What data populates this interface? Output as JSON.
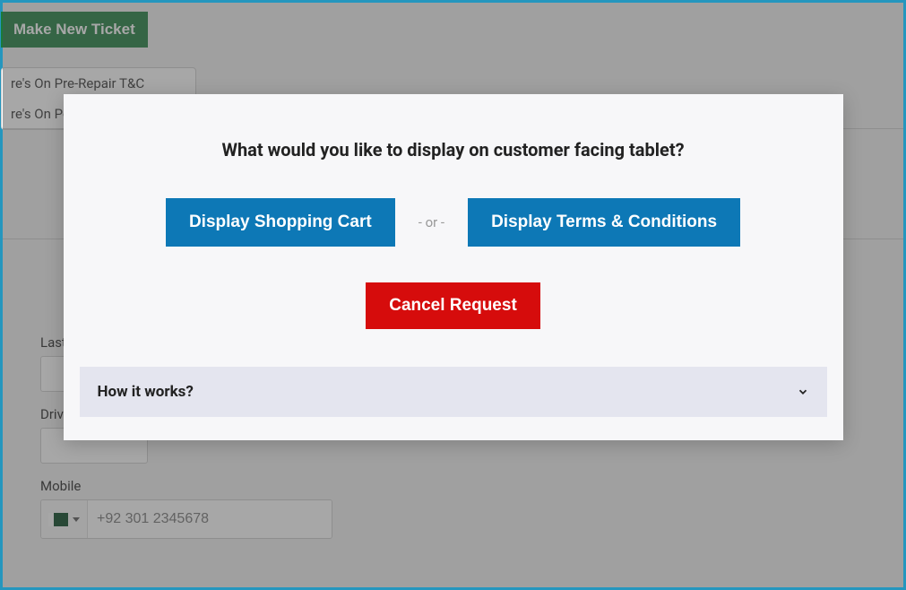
{
  "header": {
    "new_ticket_label": "Make New Ticket"
  },
  "dropdown": {
    "items": [
      "re's On Pre-Repair T&C",
      "re's On Pos"
    ]
  },
  "form": {
    "last_name_label": "Last Name",
    "driving_label": "Driving",
    "mobile_label": "Mobile",
    "mobile_placeholder": "+92 301 2345678"
  },
  "modal": {
    "title": "What would you like to display on customer facing tablet?",
    "display_cart_label": "Display Shopping Cart",
    "or_text": "- or -",
    "display_terms_label": "Display Terms & Conditions",
    "cancel_label": "Cancel Request",
    "accordion_title": "How it works?"
  }
}
